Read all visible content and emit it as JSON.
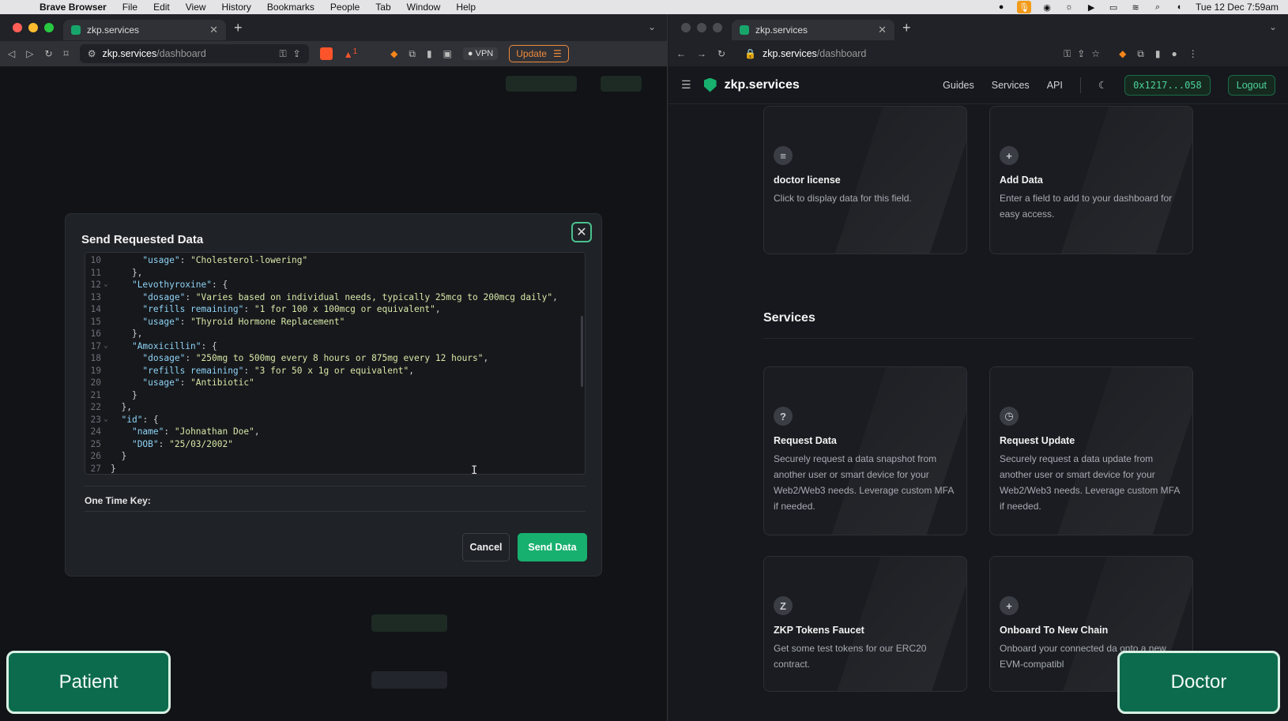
{
  "menubar": {
    "app": "Brave Browser",
    "items": [
      "File",
      "Edit",
      "View",
      "History",
      "Bookmarks",
      "People",
      "Tab",
      "Window",
      "Help"
    ],
    "clock": "Tue 12 Dec  7:59am"
  },
  "left_window": {
    "tab_title": "zkp.services",
    "url_host": "zkp.services",
    "url_path": "/dashboard",
    "vpn_label": "VPN",
    "update_label": "Update",
    "notif_count": "1"
  },
  "modal": {
    "title": "Send Requested Data",
    "close_glyph": "✕",
    "code_lines": [
      {
        "n": "10",
        "fold": "",
        "html": "      <span class='k'>\"usage\"</span>: <span class='s'>\"Cholesterol-lowering\"</span>"
      },
      {
        "n": "11",
        "fold": "",
        "html": "    },"
      },
      {
        "n": "12",
        "fold": "⌄",
        "html": "    <span class='k'>\"Levothyroxine\"</span>: {"
      },
      {
        "n": "13",
        "fold": "",
        "html": "      <span class='k'>\"dosage\"</span>: <span class='s'>\"Varies based on individual needs, typically 25mcg to 200mcg daily\"</span>,"
      },
      {
        "n": "14",
        "fold": "",
        "html": "      <span class='k'>\"refills remaining\"</span>: <span class='s'>\"1 for 100 x 100mcg or equivalent\"</span>,"
      },
      {
        "n": "15",
        "fold": "",
        "html": "      <span class='k'>\"usage\"</span>: <span class='s'>\"Thyroid Hormone Replacement\"</span>"
      },
      {
        "n": "16",
        "fold": "",
        "html": "    },"
      },
      {
        "n": "17",
        "fold": "⌄",
        "html": "    <span class='k'>\"Amoxicillin\"</span>: {"
      },
      {
        "n": "18",
        "fold": "",
        "html": "      <span class='k'>\"dosage\"</span>: <span class='s'>\"250mg to 500mg every 8 hours or 875mg every 12 hours\"</span>,"
      },
      {
        "n": "19",
        "fold": "",
        "html": "      <span class='k'>\"refills remaining\"</span>: <span class='s'>\"3 for 50 x 1g or equivalent\"</span>,"
      },
      {
        "n": "20",
        "fold": "",
        "html": "      <span class='k'>\"usage\"</span>: <span class='s'>\"Antibiotic\"</span>"
      },
      {
        "n": "21",
        "fold": "",
        "html": "    }"
      },
      {
        "n": "22",
        "fold": "",
        "html": "  },"
      },
      {
        "n": "23",
        "fold": "⌄",
        "html": "  <span class='k'>\"id\"</span>: {"
      },
      {
        "n": "24",
        "fold": "",
        "html": "    <span class='k'>\"name\"</span>: <span class='s'>\"Johnathan Doe\"</span>,"
      },
      {
        "n": "25",
        "fold": "",
        "html": "    <span class='k'>\"DOB\"</span>: <span class='s'>\"25/03/2002\"</span>"
      },
      {
        "n": "26",
        "fold": "",
        "html": "  }"
      },
      {
        "n": "27",
        "fold": "",
        "html": "}"
      }
    ],
    "one_time_key_label": "One Time Key:",
    "cancel_label": "Cancel",
    "send_label": "Send Data"
  },
  "right_window": {
    "tab_title": "zkp.services",
    "url_host": "zkp.services",
    "url_path": "/dashboard",
    "brand": "zkp.services",
    "nav": {
      "guides": "Guides",
      "services": "Services",
      "api": "API"
    },
    "wallet": "0x1217...058",
    "logout": "Logout",
    "data_cards": [
      {
        "icon": "≡",
        "title": "doctor license",
        "desc": "Click to display data for this field."
      },
      {
        "icon": "+",
        "title": "Add Data",
        "desc": "Enter a field to add to your dashboard for easy access."
      }
    ],
    "services_title": "Services",
    "service_cards": [
      {
        "icon": "?",
        "title": "Request Data",
        "desc": "Securely request a data snapshot from another user or smart device for your Web2/Web3 needs. Leverage custom MFA if needed."
      },
      {
        "icon": "◷",
        "title": "Request Update",
        "desc": "Securely request a data update from another user or smart device for your Web2/Web3 needs. Leverage custom MFA if needed."
      },
      {
        "icon": "Z",
        "title": "ZKP Tokens Faucet",
        "desc": "Get some test tokens for our ERC20 contract."
      },
      {
        "icon": "+",
        "title": "Onboard To New Chain",
        "desc": "Onboard your connected da onto a new EVM-compatibl"
      }
    ]
  },
  "overlays": {
    "patient": "Patient",
    "doctor": "Doctor"
  }
}
